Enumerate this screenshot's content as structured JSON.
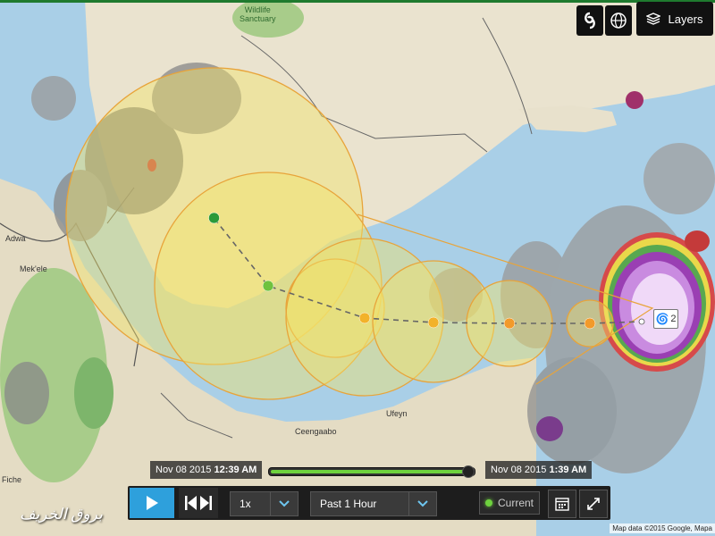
{
  "map": {
    "sanctuary_label": "Wildlife\nSanctuary",
    "place_labels": [
      {
        "text": "Adwa"
      },
      {
        "text": "Mek'ele"
      },
      {
        "text": "Fiche"
      },
      {
        "text": "Ufeyn"
      },
      {
        "text": "Ceengaabo"
      }
    ],
    "storm_badge": "2"
  },
  "controls": {
    "layers_label": "Layers",
    "buttons": [
      "hurricane-icon",
      "globe-icon"
    ]
  },
  "timeline": {
    "start_date": "Nov 08 2015",
    "start_time": "12:39 AM",
    "end_date": "Nov 08 2015",
    "end_time": "1:39 AM",
    "progress": 1.0
  },
  "player": {
    "speed": "1x",
    "range": "Past 1 Hour",
    "current_label": "Current"
  },
  "attribution": "Map data ©2015 Google, Mapa",
  "watermark": "بروق الخريف",
  "colors": {
    "accent": "#2ea0dc",
    "live": "#6ed23e",
    "forecast_cone": "#f2e36a"
  }
}
